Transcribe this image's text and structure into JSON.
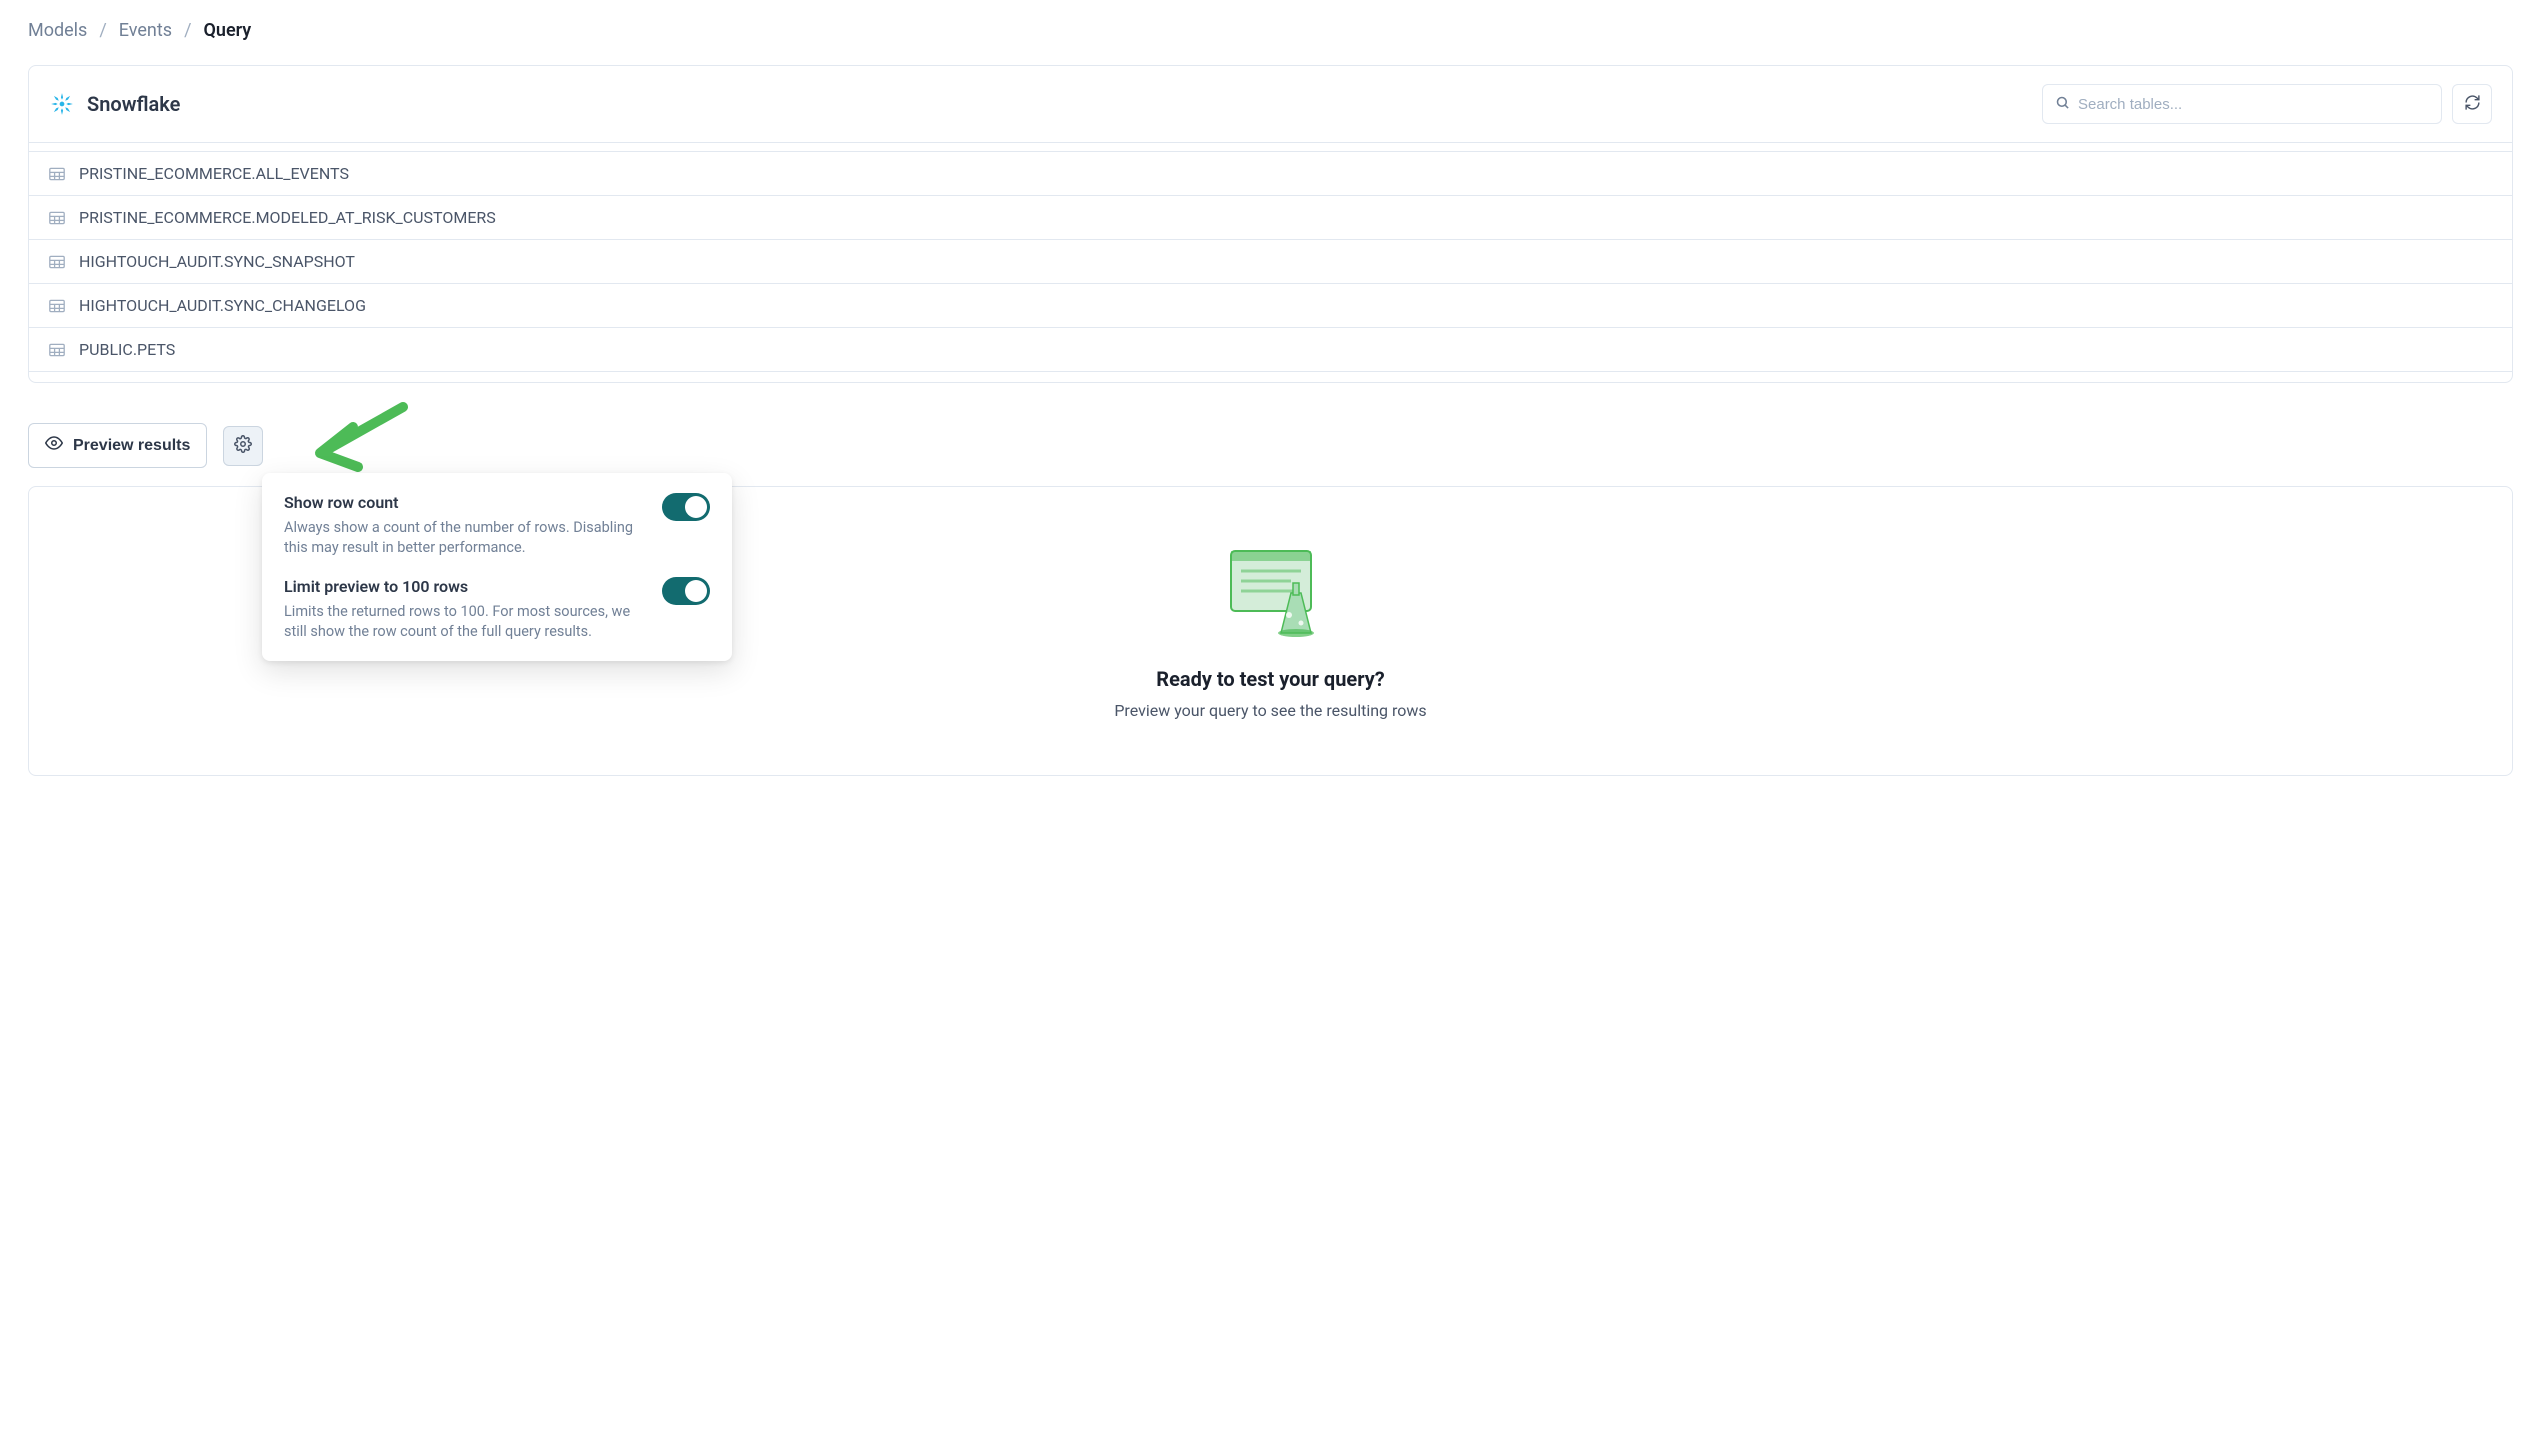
{
  "breadcrumb": {
    "items": [
      "Models",
      "Events"
    ],
    "current": "Query"
  },
  "source": {
    "name": "Snowflake"
  },
  "search": {
    "placeholder": "Search tables..."
  },
  "tables": [
    "PRISTINE_ECOMMERCE.ALL_EVENTS",
    "PRISTINE_ECOMMERCE.MODELED_AT_RISK_CUSTOMERS",
    "HIGHTOUCH_AUDIT.SYNC_SNAPSHOT",
    "HIGHTOUCH_AUDIT.SYNC_CHANGELOG",
    "PUBLIC.PETS"
  ],
  "actions": {
    "preview": "Preview results"
  },
  "settings_popover": {
    "row_count": {
      "title": "Show row count",
      "desc": "Always show a count of the number of rows. Disabling this may result in better performance.",
      "enabled": true
    },
    "limit_rows": {
      "title": "Limit preview to 100 rows",
      "desc": "Limits the returned rows to 100. For most sources, we still show the row count of the full query results.",
      "enabled": true
    }
  },
  "empty_state": {
    "title": "Ready to test your query?",
    "subtitle": "Preview your query to see the resulting rows"
  }
}
